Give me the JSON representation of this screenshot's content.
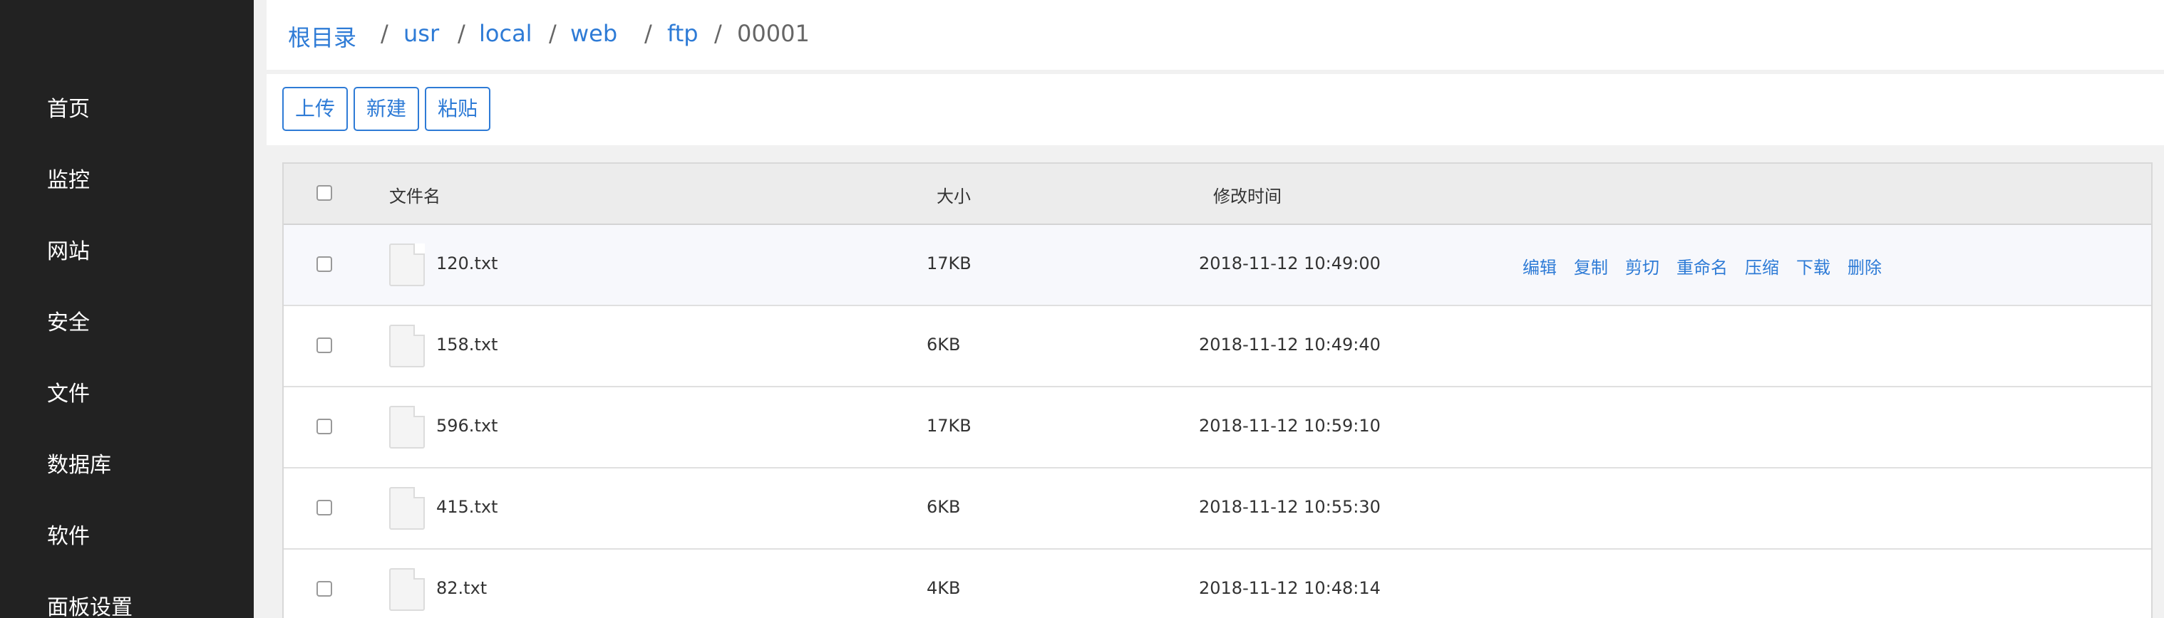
{
  "sidebar": {
    "items": [
      {
        "label": "首页"
      },
      {
        "label": "监控"
      },
      {
        "label": "网站"
      },
      {
        "label": "安全"
      },
      {
        "label": "文件"
      },
      {
        "label": "数据库"
      },
      {
        "label": "软件"
      },
      {
        "label": "面板设置"
      }
    ]
  },
  "breadcrumb": {
    "items": [
      "根目录",
      "usr",
      "local",
      "web",
      "ftp",
      "00001"
    ],
    "separator": "/"
  },
  "toolbar": {
    "upload_label": "上传",
    "new_label": "新建",
    "paste_label": "粘贴"
  },
  "table": {
    "headers": {
      "name": "文件名",
      "size": "大小",
      "modified": "修改时间"
    },
    "rows": [
      {
        "name": "120.txt",
        "size": "17KB",
        "modified": "2018-11-12 10:49:00"
      },
      {
        "name": "158.txt",
        "size": "6KB",
        "modified": "2018-11-12 10:49:40"
      },
      {
        "name": "596.txt",
        "size": "17KB",
        "modified": "2018-11-12 10:59:10"
      },
      {
        "name": "415.txt",
        "size": "6KB",
        "modified": "2018-11-12 10:55:30"
      },
      {
        "name": "82.txt",
        "size": "4KB",
        "modified": "2018-11-12 10:48:14"
      }
    ],
    "actions": [
      "编辑",
      "复制",
      "剪切",
      "重命名",
      "压缩",
      "下载",
      "删除"
    ]
  },
  "colors": {
    "sidebar_bg": "#222222",
    "accent": "#2e7bd6",
    "header_bg": "#ececec",
    "page_bg": "#f1f1f1"
  },
  "icons": {
    "file": "file-icon"
  }
}
